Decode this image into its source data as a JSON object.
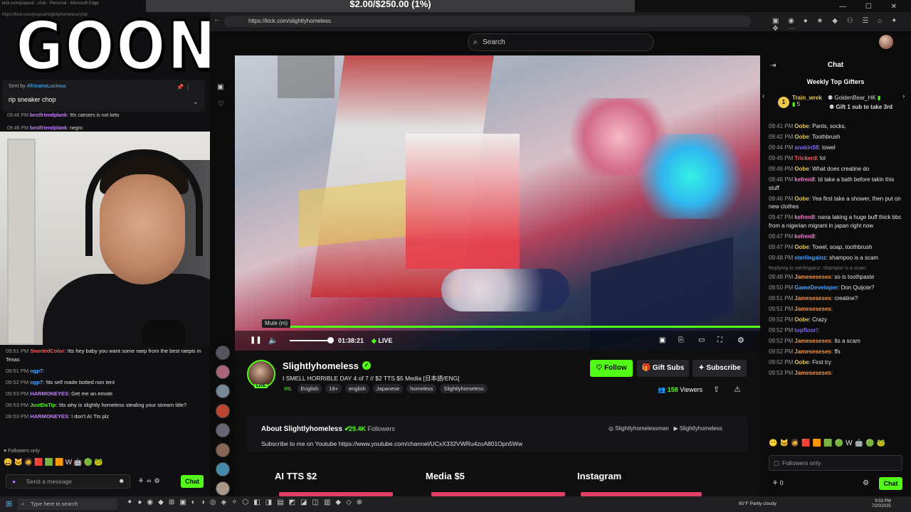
{
  "goal_bar": "$2.00/$250.00 (1%)",
  "overlay_brand": "GOONTENT",
  "browser": {
    "url": "https://kick.com/slightlyhomeless",
    "tab_text": "kick.com/popout/...chat - Personal - Microsoft Edge",
    "nav_icons": "← → ⟳",
    "window_controls": "— ☐ ✕"
  },
  "header": {
    "search_placeholder": "Search"
  },
  "video": {
    "mute_tooltip": "Mute (m)",
    "time": "01:38:21",
    "live_label": "LIVE",
    "progress_fraction": 1.0
  },
  "stream": {
    "name": "Slightlyhomeless",
    "live_badge": "LIVE",
    "title": "I SMELL HORRIBLE DAY 4 of 7 // $2 TTS $5 Media [日本語/ENG]",
    "category": "IRL",
    "tags": [
      "English",
      "18+",
      "english",
      "Japanese",
      "homeless",
      "Slightlyhomeless"
    ],
    "follow_label": "Follow",
    "gift_label": "Gift Subs",
    "subscribe_label": "Subscribe",
    "viewers_count": "158",
    "viewers_label": "Viewers"
  },
  "about": {
    "title": "About Slightlyhomeless",
    "followers_count": "29.4K",
    "followers_label": "Followers",
    "socials": "Slightlyhomelessman",
    "socials2": "Slightlyhomeless",
    "description": "Subscribe to me on Youtube https://www.youtube.com/channel/UCxX332VWRu4zoA801Opn5Ww"
  },
  "panels": [
    {
      "label": "AI TTS $2"
    },
    {
      "label": "Media $5"
    },
    {
      "label": "Instagram"
    }
  ],
  "chat": {
    "title": "Chat",
    "top_gifters_title": "Weekly Top Gifters",
    "gifter1_name": "Train_wrek",
    "gifter1_count": "5",
    "gifter2_name": "GoldenBear_HK",
    "gift_cta": "Gift 1 sub to take 3rd",
    "messages": [
      {
        "time": "09:41 PM",
        "user": "Oobe",
        "color": "#e8c94a",
        "text": "Pants, socks,"
      },
      {
        "time": "09:42 PM",
        "user": "Oobe",
        "color": "#e8c94a",
        "text": "Toothbrush"
      },
      {
        "time": "09:44 PM",
        "user": "anakin58",
        "color": "#7b68ee",
        "text": "towel"
      },
      {
        "time": "09:45 PM",
        "user": "Trickerd",
        "color": "#ff5b5b",
        "text": "lol"
      },
      {
        "time": "09:46 PM",
        "user": "Oobe",
        "color": "#e8c94a",
        "text": "What does creatine do"
      },
      {
        "time": "09:46 PM",
        "user": "kefren8",
        "color": "#f07fd0",
        "text": "Id take a bath before takin this stuff"
      },
      {
        "time": "09:46 PM",
        "user": "Oobe",
        "color": "#e8c94a",
        "text": "Yea first take a shower, then put on new clothes"
      },
      {
        "time": "09:47 PM",
        "user": "kefren8",
        "color": "#f07fd0",
        "text": "nana taking a huge buff thick bbc from a nigerian migrant in japan right now"
      },
      {
        "time": "09:47 PM",
        "user": "kefren8",
        "color": "#f07fd0",
        "text": ""
      },
      {
        "time": "09:47 PM",
        "user": "Oobe",
        "color": "#e8c94a",
        "text": "Towel, soap, toothbrush"
      },
      {
        "time": "09:48 PM",
        "user": "sterlingainz",
        "color": "#4aa3ff",
        "text": "shampoo is a scam"
      },
      {
        "time": "",
        "user": "",
        "color": "#777",
        "text": "Replying to sterlingainz: shampoo is a scam",
        "reply": true
      },
      {
        "time": "09:48 PM",
        "user": "Jameseseses",
        "color": "#f0964a",
        "text": "so is toothpaste"
      },
      {
        "time": "09:50 PM",
        "user": "GameDeveloper",
        "color": "#4aa3ff",
        "text": "Don Quijote?"
      },
      {
        "time": "09:51 PM",
        "user": "Jameseseses",
        "color": "#f0964a",
        "text": "creatine?"
      },
      {
        "time": "09:51 PM",
        "user": "Jameseseses",
        "color": "#f0964a",
        "text": ""
      },
      {
        "time": "09:52 PM",
        "user": "Oobe",
        "color": "#e8c94a",
        "text": "Crazy"
      },
      {
        "time": "09:52 PM",
        "user": "topfloor!",
        "color": "#7b68ee",
        "text": ""
      },
      {
        "time": "09:52 PM",
        "user": "Jameseseses",
        "color": "#f0964a",
        "text": "Its a scam"
      },
      {
        "time": "09:52 PM",
        "user": "Jameseseses",
        "color": "#f0964a",
        "text": "ffs"
      },
      {
        "time": "09:52 PM",
        "user": "Oobe",
        "color": "#e8c94a",
        "text": "First try"
      },
      {
        "time": "09:53 PM",
        "user": "Jameseseses",
        "color": "#f0964a",
        "text": ""
      }
    ],
    "input_placeholder": "Followers only",
    "bottom_count": "0",
    "send_label": "Chat"
  },
  "overlay_chat": {
    "pinned_sender_prefix": "Sent by",
    "pinned_sender": "AfricanoLucious",
    "pinned_message": "rip sneaker chop",
    "top_lines": [
      {
        "time": "09:46 PM",
        "user": "bestfriendplank",
        "text": "!tts caesers is not keto"
      },
      {
        "time": "09:46 PM",
        "user": "bestfriendplank",
        "text": "negro"
      }
    ],
    "messages": [
      {
        "time": "09:51 PM",
        "user": "SnortedColor",
        "color": "#ff5b5b",
        "text": "!tts hey baby you want some raep from the best raepis in Texas"
      },
      {
        "time": "09:51 PM",
        "user": "ogp7",
        "color": "#4aa3ff",
        "text": ""
      },
      {
        "time": "09:52 PM",
        "user": "ogp7",
        "color": "#4aa3ff",
        "text": "!tts self made botted non tent"
      },
      {
        "time": "09:53 PM",
        "user": "HARMONEYES",
        "color": "#c77dff",
        "text": "Get me an emote"
      },
      {
        "time": "09:53 PM",
        "user": "JustDaTip",
        "color": "#53fc18",
        "text": "!tts why is slightly homeless stealing your stream title?"
      },
      {
        "time": "09:53 PM",
        "user": "HARMONEYES",
        "color": "#c77dff",
        "text": "I don't AI Tts plz"
      }
    ],
    "followers_only": "Followers only",
    "input_placeholder": "Send a message",
    "send_label": "Chat"
  },
  "taskbar": {
    "search_placeholder": "Type here to search",
    "weather": "85°F  Partly cloudy",
    "time": "9:53 PM",
    "date": "7/20/2025"
  }
}
